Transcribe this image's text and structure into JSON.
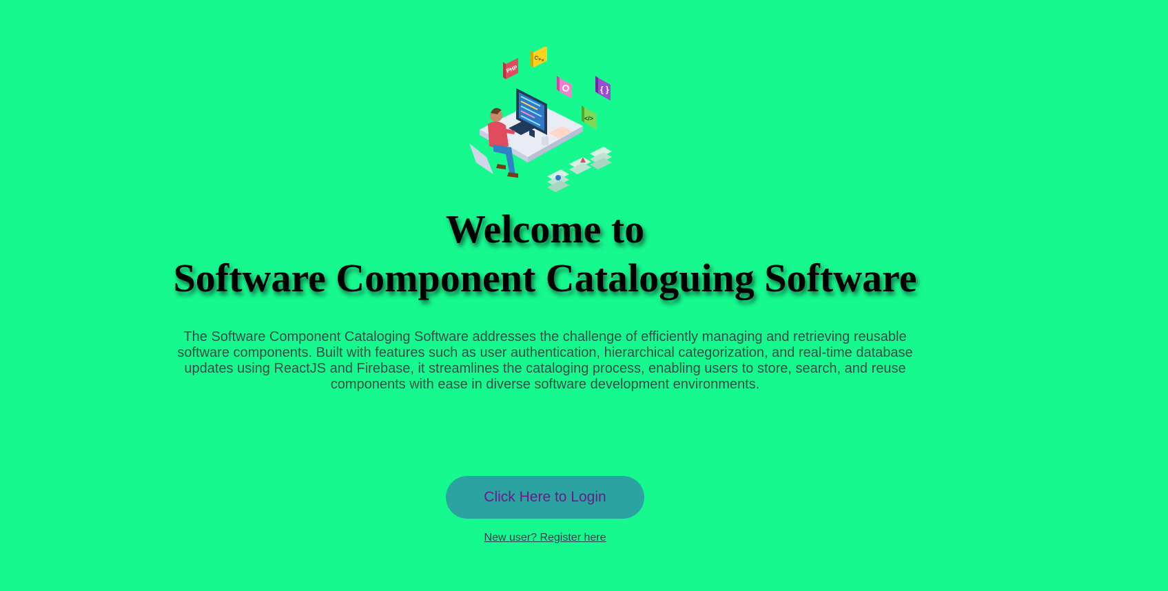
{
  "hero": {
    "title_line1": "Welcome to",
    "title_line2": "Software Component Cataloguing Software",
    "description": "The Software Component Cataloging Software addresses the challenge of efficiently managing and retrieving reusable software components. Built with features such as user authentication, hierarchical categorization, and real-time database updates using ReactJS and Firebase, it streamlines the cataloging process, enabling users to store, search, and reuse components with ease in diverse software development environments."
  },
  "illustration": {
    "icon": "developer-at-computer-illustration",
    "badge_php": "PHP",
    "badge_cpp": "C++",
    "badge_code": "</>",
    "badge_braces": "{ }"
  },
  "actions": {
    "login_label": "Click Here to Login",
    "register_label": "New user? Register here"
  },
  "colors": {
    "background": "#16f98f",
    "button": "#2aa3a1",
    "button_text": "#6a1b8a",
    "description_text": "#2f4f47"
  }
}
